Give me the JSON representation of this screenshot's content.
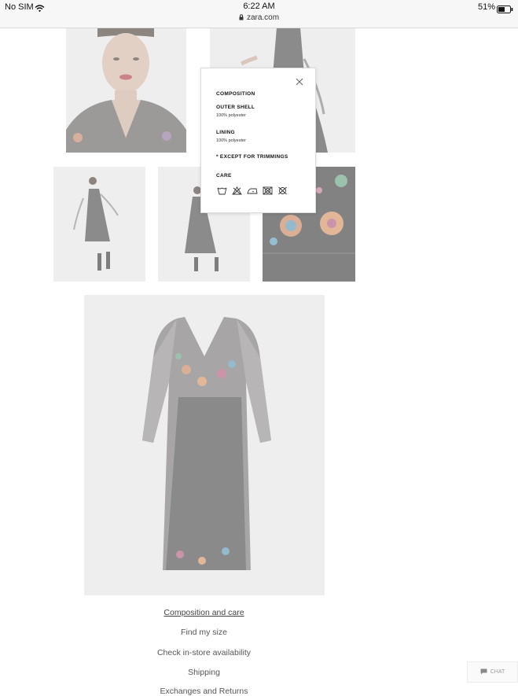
{
  "status_bar": {
    "carrier": "No SIM",
    "time": "6:22 AM",
    "url": "zara.com",
    "battery": "51%"
  },
  "composition_modal": {
    "composition_heading": "COMPOSITION",
    "outer_shell_label": "OUTER SHELL",
    "outer_shell_value": "100% polyester",
    "lining_label": "LINING",
    "lining_value": "100% polyester",
    "trimmings_note": "* EXCEPT FOR TRIMMINGS",
    "care_heading": "CARE",
    "care_icons": [
      "wash-30-icon",
      "do-not-bleach-icon",
      "iron-low-icon",
      "do-not-tumble-dry-icon",
      "do-not-dry-clean-icon"
    ]
  },
  "product_links": [
    "Composition and care",
    "Find my size",
    "Check in-store availability",
    "Shipping",
    "Exchanges and Returns"
  ],
  "chat": {
    "label": "CHAT"
  }
}
